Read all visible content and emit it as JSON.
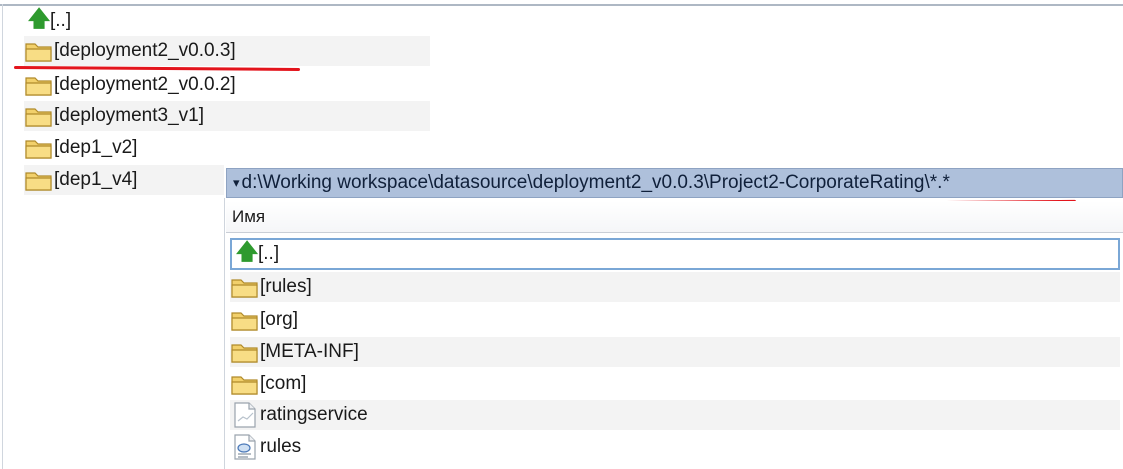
{
  "left_panel": {
    "items": [
      {
        "label": "[..]",
        "icon": "up-arrow-icon"
      },
      {
        "label": "[deployment2_v0.0.3]",
        "icon": "folder-icon"
      },
      {
        "label": "[deployment2_v0.0.2]",
        "icon": "folder-icon"
      },
      {
        "label": "[deployment3_v1]",
        "icon": "folder-icon"
      },
      {
        "label": "[dep1_v2]",
        "icon": "folder-icon"
      },
      {
        "label": "[dep1_v4]",
        "icon": "folder-icon"
      }
    ]
  },
  "right_panel": {
    "path": "d:\\Working workspace\\datasource\\deployment2_v0.0.3\\Project2-CorporateRating\\*.*",
    "path_chevron": "▾",
    "column_header": "Имя",
    "items": [
      {
        "label": "[..]",
        "icon": "up-arrow-icon"
      },
      {
        "label": "[rules]",
        "icon": "folder-icon"
      },
      {
        "label": "[org]",
        "icon": "folder-icon"
      },
      {
        "label": "[META-INF]",
        "icon": "folder-icon"
      },
      {
        "label": "[com]",
        "icon": "folder-icon"
      },
      {
        "label": "ratingservice",
        "icon": "file-icon"
      },
      {
        "label": "rules",
        "icon": "xml-file-icon"
      }
    ]
  },
  "colors": {
    "annotation_underline": "#e3141c",
    "path_bar": "#aec0db",
    "folder": "#f2d06b",
    "up_arrow": "#2e9a2e"
  }
}
